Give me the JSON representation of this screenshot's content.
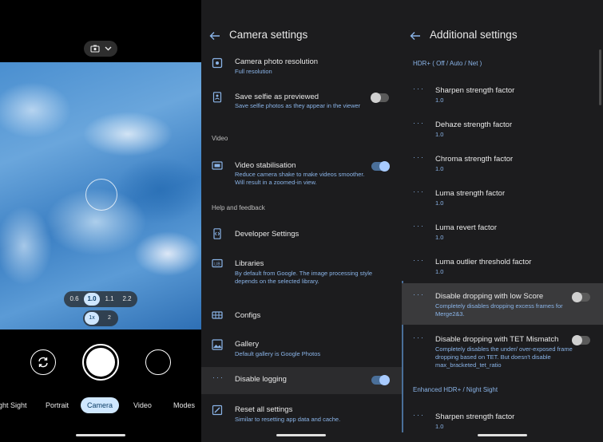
{
  "camera": {
    "zoom_levels": [
      "0.6",
      "1.0",
      "1.1",
      "2.2"
    ],
    "zoom_active_index": 1,
    "lens_options": [
      "1x",
      "2"
    ],
    "lens_active_index": 0,
    "modes": [
      "ght Sight",
      "Portrait",
      "Camera",
      "Video",
      "Modes"
    ],
    "active_mode_index": 2
  },
  "camera_settings": {
    "title": "Camera settings",
    "items": [
      {
        "icon": "photo-resolution-icon",
        "title": "Camera photo resolution",
        "subtitle": "Full resolution"
      },
      {
        "icon": "selfie-icon",
        "title": "Save selfie as previewed",
        "subtitle": "Save selfie photos as they appear in the viewer",
        "toggle": false
      }
    ],
    "video_section": "Video",
    "video_items": [
      {
        "icon": "stabilisation-icon",
        "title": "Video stabilisation",
        "subtitle": "Reduce camera shake to make videos smoother. Will result in a zoomed-in view.",
        "toggle": true
      }
    ],
    "help_section": "Help and feedback",
    "help_items": [
      {
        "icon": "developer-icon",
        "title": "Developer Settings",
        "subtitle": ""
      },
      {
        "icon": "libraries-icon",
        "title": "Libraries",
        "subtitle": "By default from Google. The image processing style depends on the selected library."
      },
      {
        "icon": "configs-icon",
        "title": "Configs",
        "subtitle": ""
      },
      {
        "icon": "gallery-icon",
        "title": "Gallery",
        "subtitle": "Default gallery is Google Photos"
      },
      {
        "icon": "dots-icon",
        "title": "Disable logging",
        "subtitle": "",
        "toggle": true
      },
      {
        "icon": "reset-icon",
        "title": "Reset all settings",
        "subtitle": "Similar to resetting app data and cache."
      }
    ]
  },
  "additional_settings": {
    "title": "Additional settings",
    "hdr_section": "HDR+ ( Off / Auto / Net )",
    "items": [
      {
        "title": "Sharpen strength factor",
        "value": "1.0"
      },
      {
        "title": "Dehaze strength factor",
        "value": "1.0"
      },
      {
        "title": "Chroma strength factor",
        "value": "1.0"
      },
      {
        "title": "Luma strength factor",
        "value": "1.0"
      },
      {
        "title": "Luma revert factor",
        "value": "1.0"
      },
      {
        "title": "Luma outlier threshold factor",
        "value": "1.0"
      }
    ],
    "toggle_items": [
      {
        "title": "Disable dropping with low Score",
        "subtitle": "Completely disables dropping excess frames for Merge2&3.",
        "toggle": false
      },
      {
        "title": "Disable dropping with TET Mismatch",
        "subtitle": "Completely disables the under/ over-exposed frame dropping based on TET. But doesn't disable max_bracketed_tet_ratio",
        "toggle": false
      }
    ],
    "enhanced_section": "Enhanced HDR+ / Night Sight",
    "enhanced_items": [
      {
        "title": "Sharpen strength factor",
        "value": "1.0"
      }
    ]
  },
  "colors": {
    "accent": "#8ab4e8",
    "panel_bg": "#1c1c1e",
    "chip_active": "#cfe7ff"
  }
}
